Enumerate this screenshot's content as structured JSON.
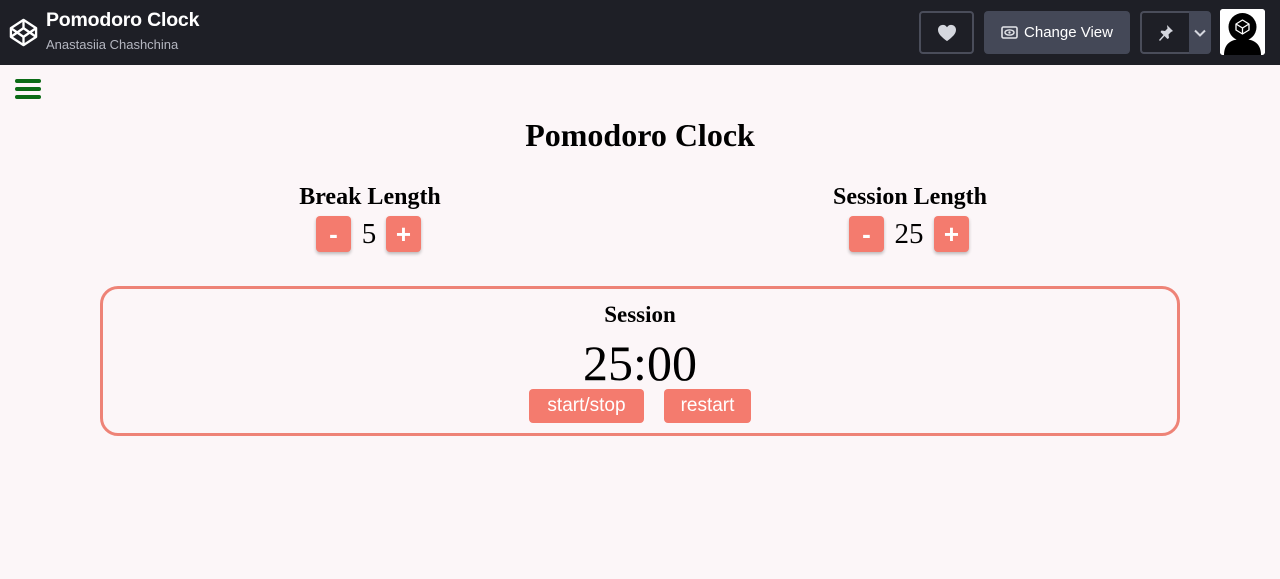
{
  "header": {
    "title": "Pomodoro Clock",
    "author": "Anastasiia Chashchina",
    "change_view_label": "Change View",
    "icons": [
      "codepen-logo-icon",
      "heart-icon",
      "eye-icon",
      "pin-icon",
      "chevron-down-icon",
      "avatar"
    ]
  },
  "app": {
    "title": "Pomodoro Clock",
    "break": {
      "label": "Break Length",
      "value": "5",
      "dec": "-",
      "inc": "+"
    },
    "session": {
      "label": "Session Length",
      "value": "25",
      "dec": "-",
      "inc": "+"
    },
    "timer": {
      "label": "Session",
      "value": "25:00",
      "start_label": "start/stop",
      "restart_label": "restart"
    }
  },
  "colors": {
    "topbar": "#1e1f26",
    "accent": "#f47b6e",
    "border": "#ee8377",
    "hamburger": "#0b6b16",
    "background": "#fcf6f8"
  }
}
